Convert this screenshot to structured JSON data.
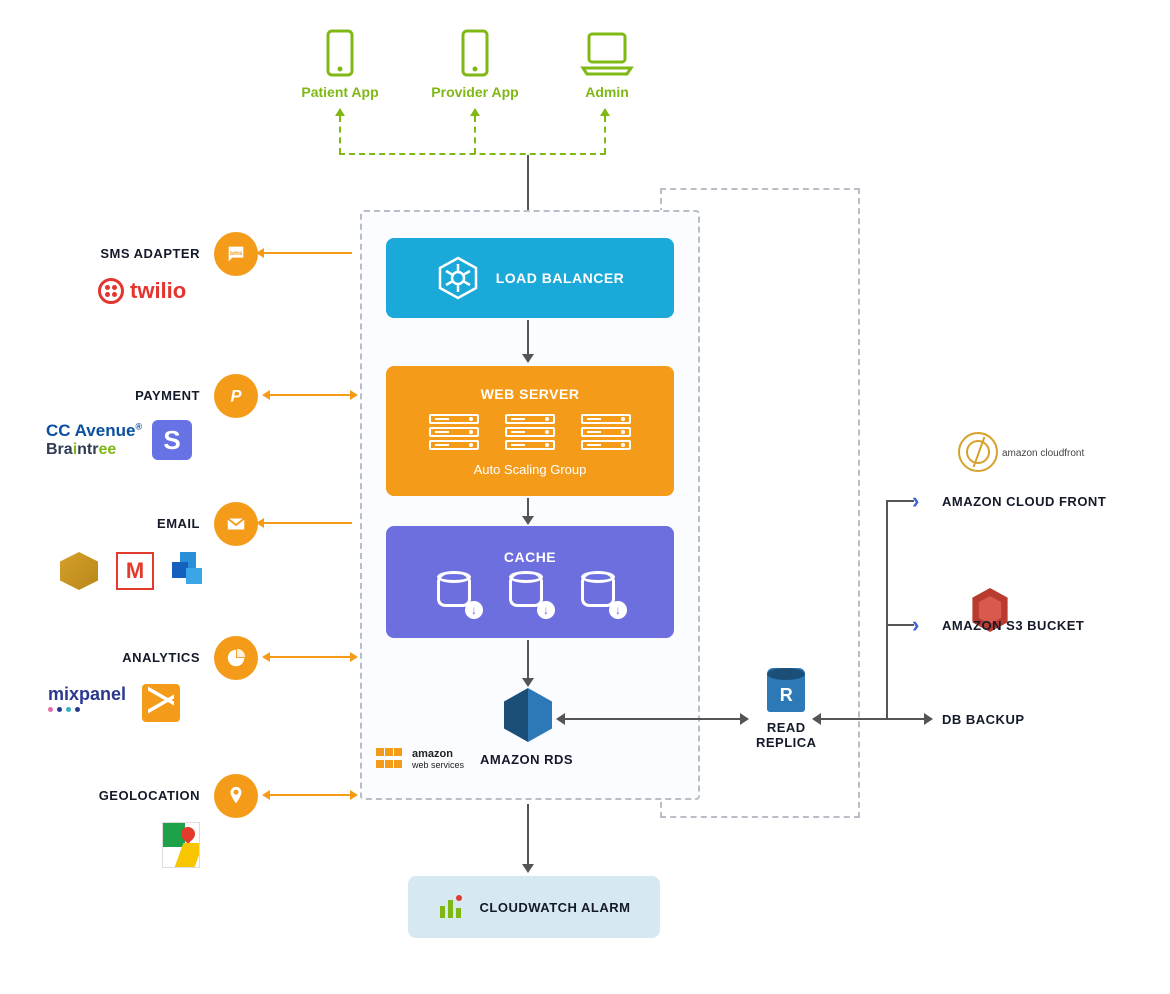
{
  "clients": {
    "patient": "Patient App",
    "provider": "Provider App",
    "admin": "Admin"
  },
  "adapters": {
    "sms": {
      "title": "SMS ADAPTER",
      "vendor_twilio": "twilio"
    },
    "payment": {
      "title": "PAYMENT",
      "cc": "CC Avenue",
      "braintree": "Braintree"
    },
    "email": {
      "title": "EMAIL"
    },
    "analytics": {
      "title": "ANALYTICS",
      "mixpanel": "mixpanel"
    },
    "geolocation": {
      "title": "GEOLOCATION"
    }
  },
  "core": {
    "load_balancer": "LOAD BALANCER",
    "web_server": "WEB SERVER",
    "auto_scaling": "Auto Scaling Group",
    "cache": "CACHE",
    "rds": "AMAZON RDS",
    "aws_label_top": "amazon",
    "aws_label_bottom": "web services"
  },
  "replica": {
    "title_l1": "READ",
    "title_l2": "REPLICA"
  },
  "right": {
    "cloudfront_sub": "amazon cloudfront",
    "cloudfront": "AMAZON CLOUD FRONT",
    "s3": "AMAZON S3 BUCKET",
    "db_backup": "DB BACKUP"
  },
  "bottom": {
    "cloudwatch": "CLOUDWATCH ALARM"
  }
}
